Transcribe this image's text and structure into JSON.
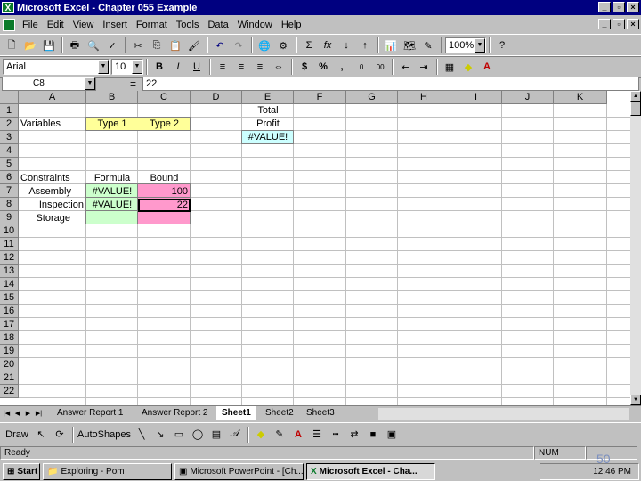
{
  "window": {
    "title": "Microsoft Excel - Chapter 055 Example",
    "min": "_",
    "restore": "▫",
    "close": "×"
  },
  "menu": [
    "File",
    "Edit",
    "View",
    "Insert",
    "Format",
    "Tools",
    "Data",
    "Window",
    "Help"
  ],
  "toolbar": {
    "zoom": "100%",
    "font": "Arial",
    "size": "10",
    "bold": "B",
    "italic": "I",
    "underline": "U",
    "sum": "Σ",
    "fx": "fx",
    "currency": "$",
    "percent": "%",
    "comma": ","
  },
  "formula": {
    "cell": "C8",
    "eq": "=",
    "value": "22"
  },
  "columns": [
    "A",
    "B",
    "C",
    "D",
    "E",
    "F",
    "G",
    "H",
    "I",
    "J",
    "K"
  ],
  "rows": [
    "1",
    "2",
    "3",
    "4",
    "5",
    "6",
    "7",
    "8",
    "9",
    "10",
    "11",
    "12",
    "13",
    "14",
    "15",
    "16",
    "17",
    "18",
    "19",
    "20",
    "21",
    "22"
  ],
  "cells": {
    "e1": "Total",
    "a2": "Variables",
    "b2": "Type 1",
    "c2": "Type 2",
    "e2": "Profit",
    "e3": "#VALUE!",
    "a6": "Constraints",
    "b6": "Formula",
    "c6": "Bound",
    "a7": "Assembly",
    "b7": "#VALUE!",
    "c7": "100",
    "a8": "Inspection",
    "b8": "#VALUE!",
    "c8": "22",
    "a9": "Storage"
  },
  "colors": {
    "yellow": "#ffff99",
    "green": "#ccffcc",
    "pink": "#ff99cc",
    "cyan": "#ccffff"
  },
  "tabs": [
    "Answer Report 1",
    "Answer Report 2",
    "Sheet1",
    "Sheet2",
    "Sheet3"
  ],
  "drawbar": {
    "draw": "Draw",
    "autoshapes": "AutoShapes"
  },
  "status": {
    "ready": "Ready",
    "num": "NUM"
  },
  "taskbar": {
    "start": "Start",
    "items": [
      "Exploring - Pom",
      "Microsoft PowerPoint - [Ch...",
      "Microsoft Excel - Cha..."
    ],
    "time": "12:46 PM"
  },
  "page_number": "50"
}
